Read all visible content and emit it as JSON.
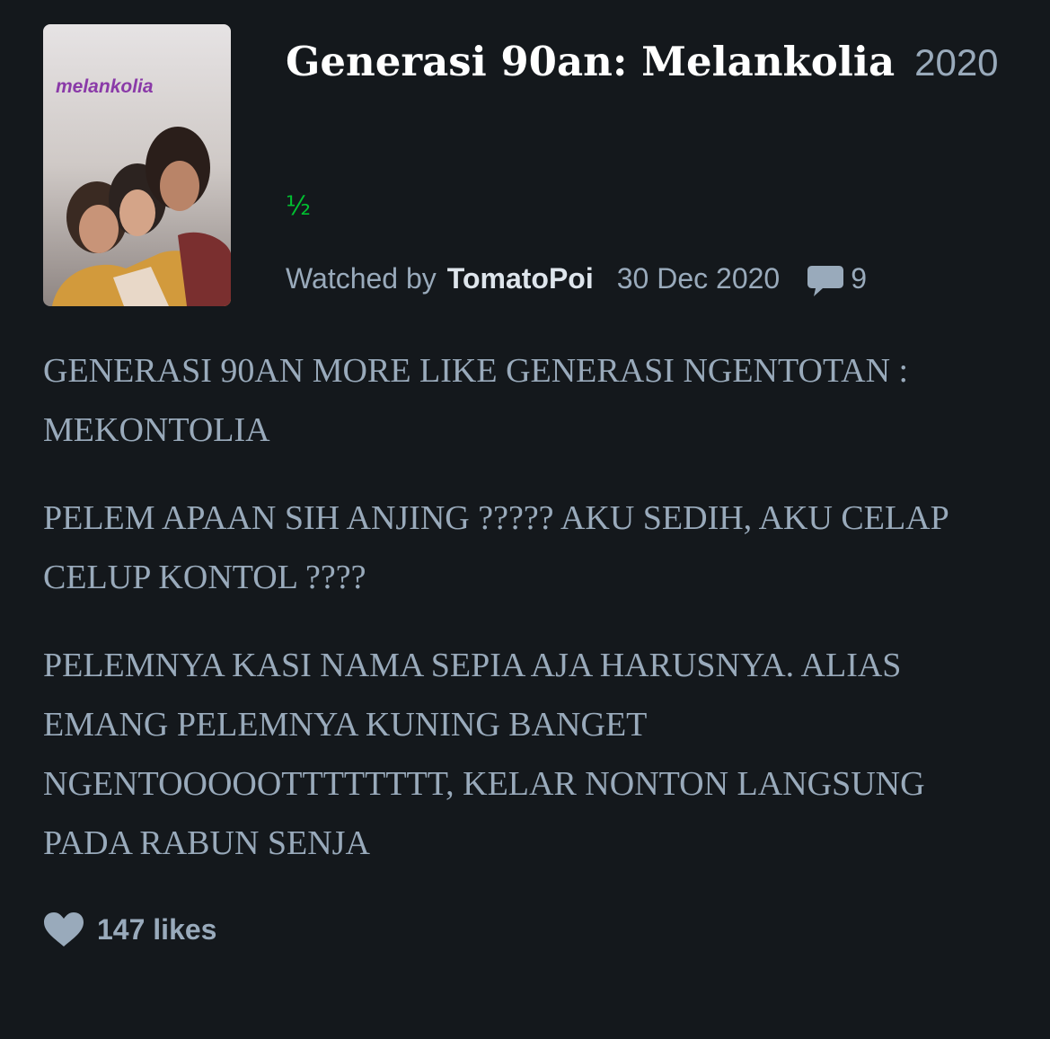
{
  "film": {
    "title": "Generasi 90an: Melankolia",
    "year": "2020",
    "poster_logo_text": "melankolia"
  },
  "review": {
    "rating_display": "½",
    "watched_by_label": "Watched by",
    "username": "TomatoPoi",
    "date": "30 Dec 2020",
    "comment_count": "9",
    "paragraphs": [
      "GENERASI 90AN MORE LIKE GENERASI NGENTOTAN : MEKONTOLIA",
      "PELEM APAAN SIH ANJING ????? AKU SEDIH, AKU CELAP CELUP KONTOL ????",
      "PELEMNYA KASI NAMA SEPIA AJA HARUSNYA. ALIAS EMANG PELEMNYA KUNING BANGET NGENTOOOOOTTTTTTTT, KELAR NONTON LANGSUNG PADA RABUN SENJA"
    ],
    "likes_text": "147 likes"
  },
  "icons": {
    "comment": "comment-bubble-icon",
    "like": "heart-icon"
  },
  "colors": {
    "background": "#14181c",
    "rating_green": "#00c030",
    "muted_text": "#99aabb",
    "title_white": "#ffffff"
  }
}
